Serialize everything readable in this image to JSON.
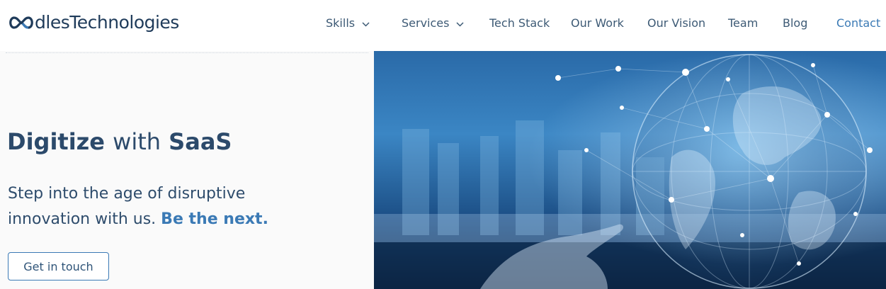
{
  "brand": {
    "logo_text_a": "dles",
    "logo_text_b": "Technologies"
  },
  "nav": {
    "items": [
      {
        "label": "Skills",
        "dropdown": true
      },
      {
        "label": "Services",
        "dropdown": true
      },
      {
        "label": "Tech Stack",
        "dropdown": false
      },
      {
        "label": "Our Work",
        "dropdown": false
      },
      {
        "label": "Our Vision",
        "dropdown": false
      },
      {
        "label": "Team",
        "dropdown": false
      },
      {
        "label": "Blog",
        "dropdown": false
      },
      {
        "label": "Contact",
        "dropdown": false
      }
    ]
  },
  "hero": {
    "headline_word1": "Digitize",
    "headline_word2": "with",
    "headline_word3": "SaaS",
    "sub_line1": "Step into the age of disruptive",
    "sub_line2": "innovation with us.",
    "sub_accent": "Be the next.",
    "cta_label": "Get in touch",
    "image_alt": "hand-touching-digital-globe-network"
  },
  "colors": {
    "brand_dark": "#1f3b5a",
    "accent": "#3b7ab5",
    "hero_left_bg": "#fafafa"
  }
}
